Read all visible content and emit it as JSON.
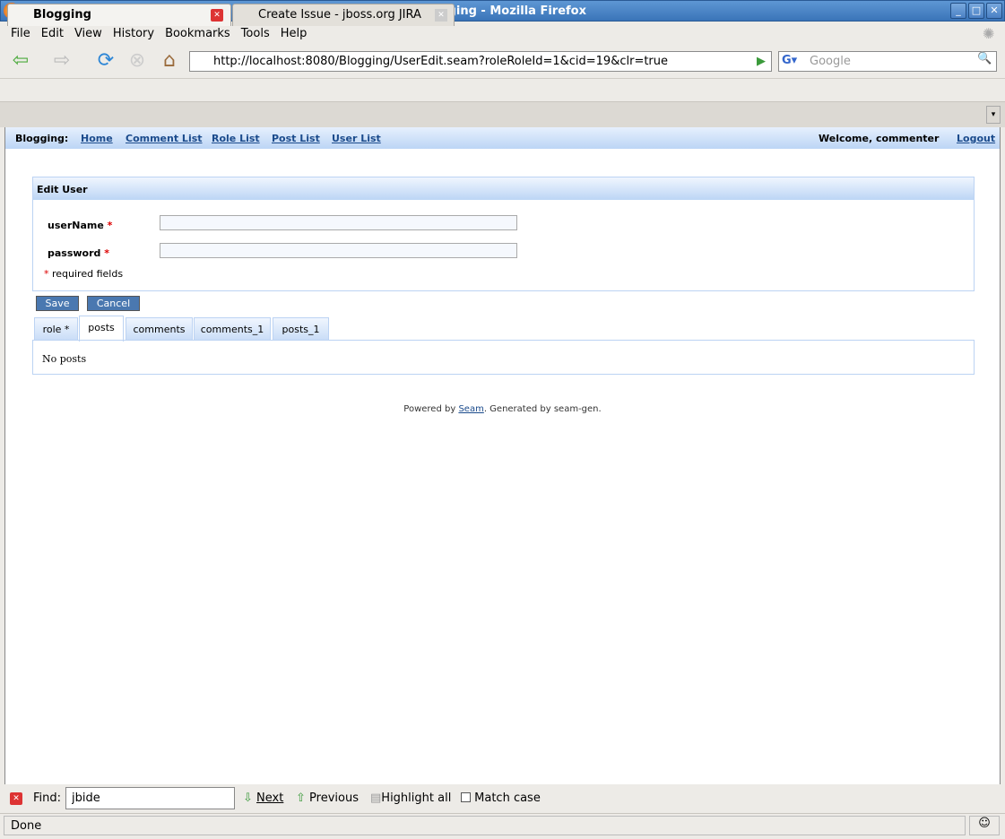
{
  "window": {
    "title": "Blogging - Mozilla Firefox"
  },
  "menu": [
    "File",
    "Edit",
    "View",
    "History",
    "Bookmarks",
    "Tools",
    "Help"
  ],
  "toolbar": {
    "url": "http://localhost:8080/Blogging/UserEdit.seam?roleRoleId=1&cid=19&clr=true",
    "search_placeholder": "Google"
  },
  "tabs": [
    {
      "label": "Blogging"
    },
    {
      "label": "Create Issue - jboss.org JIRA"
    }
  ],
  "site": {
    "brand": "Blogging:",
    "links": [
      "Home",
      "Comment List",
      "Role List",
      "Post List",
      "User List"
    ],
    "welcome": "Welcome, commenter",
    "logout": "Logout"
  },
  "form": {
    "title": "Edit User",
    "fields": [
      {
        "label": "userName",
        "value": ""
      },
      {
        "label": "password",
        "value": ""
      }
    ],
    "required_star": "*",
    "required_note": "required fields",
    "save": "Save",
    "cancel": "Cancel"
  },
  "subtabs": [
    "role *",
    "posts",
    "comments",
    "comments_1",
    "posts_1"
  ],
  "subtab_content": "No posts",
  "footer": {
    "prefix": "Powered by ",
    "link": "Seam",
    "suffix": ". Generated by seam-gen."
  },
  "find": {
    "label": "Find:",
    "value": "jbide",
    "next": "Next",
    "previous": "Previous",
    "highlight": "Highlight all",
    "match_case": "Match case"
  },
  "status": "Done"
}
